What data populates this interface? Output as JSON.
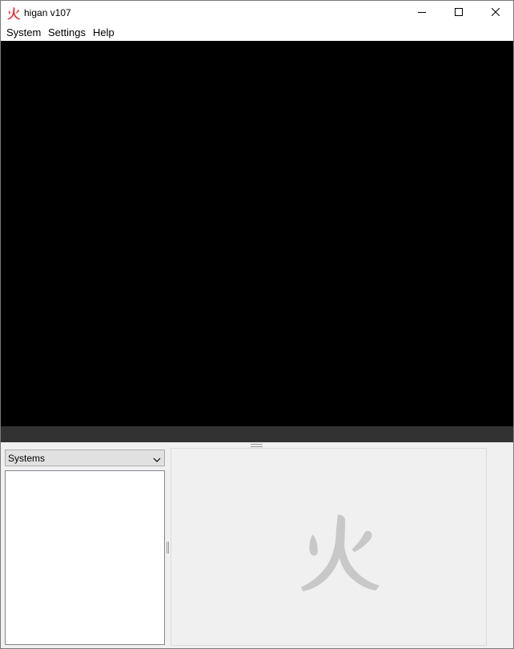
{
  "window": {
    "title": "higan v107",
    "app_icon": "fire-kanji-icon",
    "controls": [
      "minimize-icon",
      "maximize-icon",
      "close-icon"
    ]
  },
  "menu": {
    "items": [
      {
        "label": "System"
      },
      {
        "label": "Settings"
      },
      {
        "label": "Help"
      }
    ]
  },
  "viewport": {
    "background": "#000000",
    "status_band_color": "#323232"
  },
  "panel": {
    "system_select": {
      "selected": "Systems"
    },
    "system_list": [],
    "preview_watermark": "fire-kanji-icon"
  },
  "colors": {
    "accent_icon": "#e0262b",
    "watermark": "#c8c8c8",
    "panel_bg": "#f0f0f0"
  }
}
